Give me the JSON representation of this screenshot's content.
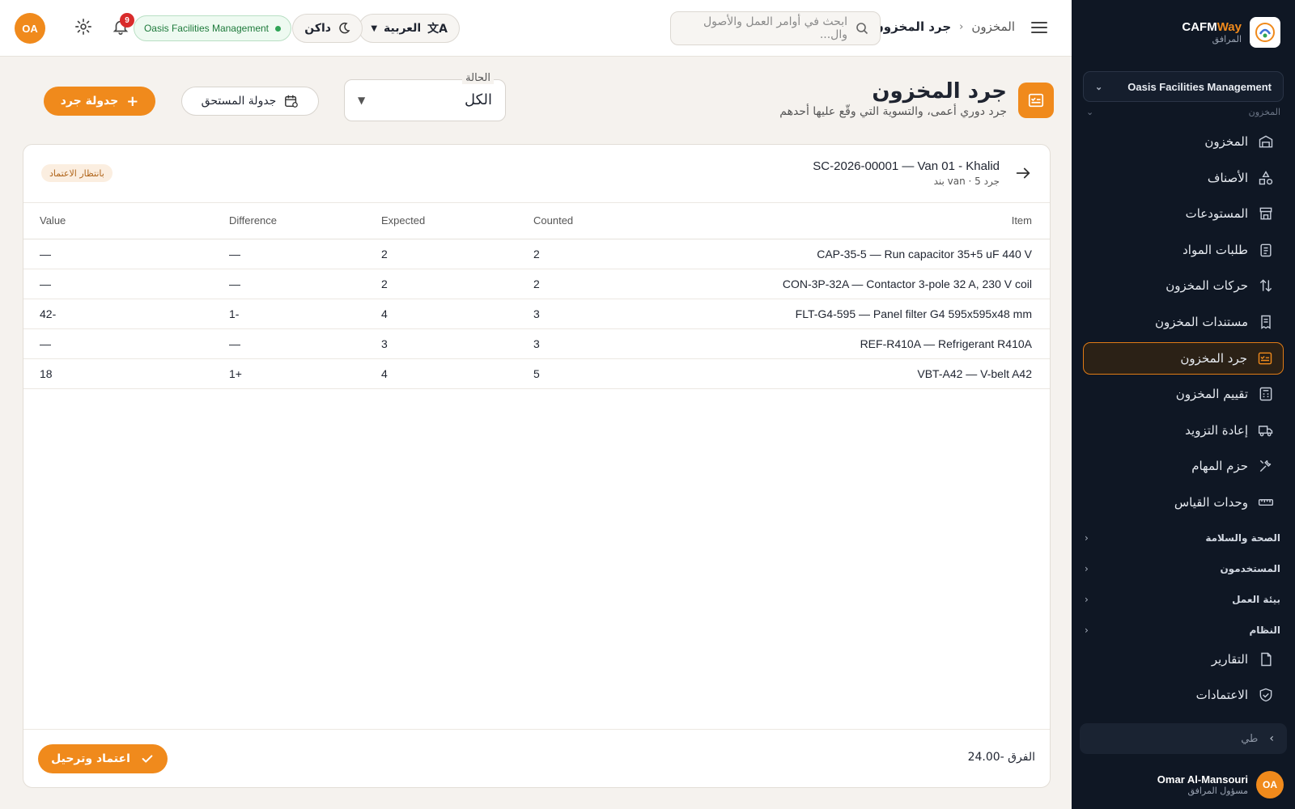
{
  "sidebar": {
    "brand_prefix": "CAFM",
    "brand_suffix": "Way",
    "brand_sub": "المرافق",
    "org_select": "Oasis Facilities Management",
    "section_faded": "المخزون",
    "items": [
      {
        "label": "المخزون",
        "icon": "warehouse-icon"
      },
      {
        "label": "الأصناف",
        "icon": "shapes-icon"
      },
      {
        "label": "المستودعات",
        "icon": "store-icon"
      },
      {
        "label": "طلبات المواد",
        "icon": "clipboard-icon"
      },
      {
        "label": "حركات المخزون",
        "icon": "swap-icon"
      },
      {
        "label": "مستندات المخزون",
        "icon": "receipt-icon"
      },
      {
        "label": "جرد المخزون",
        "icon": "checklist-icon",
        "active": true
      },
      {
        "label": "تقييم المخزون",
        "icon": "calculator-icon"
      },
      {
        "label": "إعادة التزويد",
        "icon": "truck-icon"
      },
      {
        "label": "حزم المهام",
        "icon": "tools-icon"
      },
      {
        "label": "وحدات القياس",
        "icon": "ruler-icon"
      }
    ],
    "groups": [
      "الصحة والسلامة",
      "المستخدمون",
      "بيئة العمل",
      "النظام"
    ],
    "bottom_items": [
      {
        "label": "التقارير",
        "icon": "report-icon"
      },
      {
        "label": "الاعتمادات",
        "icon": "shield-check-icon"
      }
    ],
    "collapse_label": "طي",
    "user": {
      "initials": "OA",
      "name": "Omar Al-Mansouri",
      "role": "مسؤول المرافق"
    }
  },
  "header": {
    "breadcrumb": {
      "parent": "المخزون",
      "current": "جرد المخزون"
    },
    "search_placeholder": "ابحث في أوامر العمل والأصول وال...",
    "language": "العربية",
    "theme": "داكن",
    "org_pill": "Oasis Facilities Management",
    "notifications_count": "9",
    "avatar_initials": "OA"
  },
  "page": {
    "title": "جرد المخزون",
    "subtitle": "جرد دوري أعمى، والتسوية التي وقّع عليها أحدهم",
    "status_label": "الحالة",
    "status_value": "الكل",
    "due_button": "جدولة المستحق",
    "schedule_button": "جدولة جرد"
  },
  "count": {
    "title": "SC-2026-00001 — Van 01 - Khalid",
    "subtitle": "جرد van · 5 بند",
    "status_badge": "بانتظار الاعتماد",
    "columns": [
      "Item",
      "Counted",
      "Expected",
      "Difference",
      "Value"
    ],
    "rows": [
      {
        "item": "CAP-35-5 — Run capacitor 35+5 uF 440 V",
        "counted": "2",
        "expected": "2",
        "difference": "—",
        "value": "—",
        "tone": ""
      },
      {
        "item": "CON-3P-32A — Contactor 3-pole 32 A, 230 V coil",
        "counted": "2",
        "expected": "2",
        "difference": "—",
        "value": "—",
        "tone": ""
      },
      {
        "item": "FLT-G4-595 — Panel filter G4 595x595x48 mm",
        "counted": "3",
        "expected": "4",
        "difference": "-1",
        "value": "-42",
        "tone": "neg"
      },
      {
        "item": "REF-R410A — Refrigerant R410A",
        "counted": "3",
        "expected": "3",
        "difference": "—",
        "value": "—",
        "tone": ""
      },
      {
        "item": "VBT-A42 — V-belt A42",
        "counted": "5",
        "expected": "4",
        "difference": "+1",
        "value": "18",
        "tone": "pos"
      }
    ],
    "difference_total": "الفرق -24.00",
    "approve_button": "اعتماد وترحيل"
  },
  "colors": {
    "accent": "#f08a1c",
    "sidebar_bg": "#0f1724",
    "negative": "#c0392b",
    "positive": "#2e9a4f"
  }
}
